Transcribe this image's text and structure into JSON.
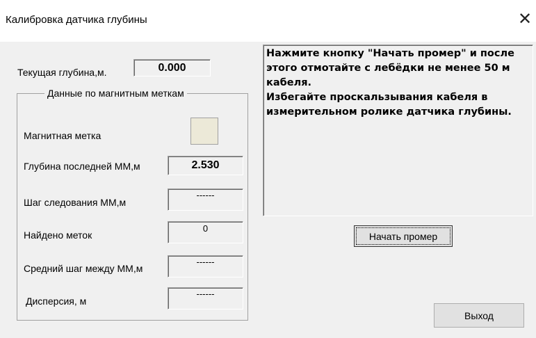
{
  "window": {
    "title": "Калибровка датчика глубины",
    "close_glyph": "✕"
  },
  "current_depth": {
    "label": "Текущая глубина,м.",
    "value": "0.000"
  },
  "magnetic_group": {
    "title": "Данные по магнитным меткам",
    "magnetic_mark_label": "Магнитная метка",
    "last_mm_depth_label": "Глубина последней ММ,м",
    "last_mm_depth_value": "2.530",
    "step_label": "Шаг следования ММ,м",
    "step_value": "------",
    "found_label": "Найдено меток",
    "found_value": "0",
    "avg_step_label": "Средний шаг между ММ,м",
    "avg_step_value": "------",
    "dispersion_label": "Дисперсия, м",
    "dispersion_value": "------"
  },
  "instructions": {
    "line1": "Нажмите кнопку \"Начать промер\" и после этого отмотайте с лебёдки не менее 50 м кабеля.",
    "line2": "Избегайте проскальзывания кабеля в измерительном ролике датчика глубины."
  },
  "buttons": {
    "start": "Начать промер",
    "exit": "Выход"
  },
  "colors": {
    "window_bg": "#f0f0f0",
    "titlebar_bg": "#ffffff",
    "indicator": "#ece9d8"
  }
}
